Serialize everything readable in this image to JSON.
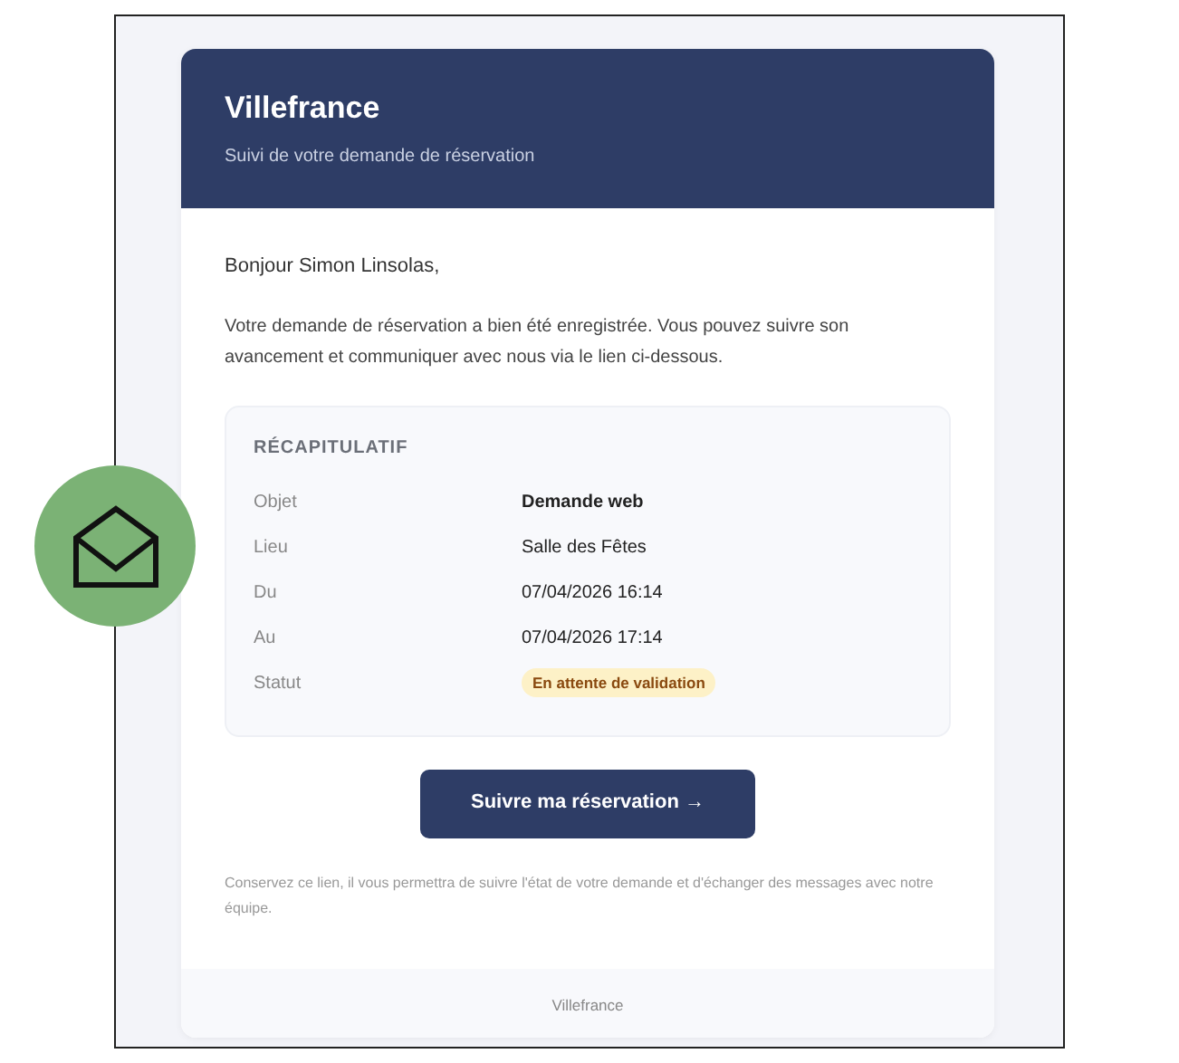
{
  "header": {
    "title": "Villefrance",
    "subtitle": "Suivi de votre demande de réservation"
  },
  "greeting": "Bonjour Simon Linsolas,",
  "intro": "Votre demande de réservation a bien été enregistrée. Vous pouvez suivre son avancement et communiquer avec nous via le lien ci-dessous.",
  "summary": {
    "title": "RÉCAPITULATIF",
    "rows": [
      {
        "label": "Objet",
        "value": "Demande web",
        "kind": "bold"
      },
      {
        "label": "Lieu",
        "value": "Salle des Fêtes",
        "kind": "plain"
      },
      {
        "label": "Du",
        "value": "07/04/2026 16:14",
        "kind": "plain"
      },
      {
        "label": "Au",
        "value": "07/04/2026 17:14",
        "kind": "plain"
      },
      {
        "label": "Statut",
        "value": "En attente de validation",
        "kind": "badge"
      }
    ]
  },
  "button": "Suivre ma réservation →",
  "note": "Conservez ce lien, il vous permettra de suivre l'état de votre demande et d'échanger des messages avec notre équipe.",
  "footer": "Villefrance"
}
